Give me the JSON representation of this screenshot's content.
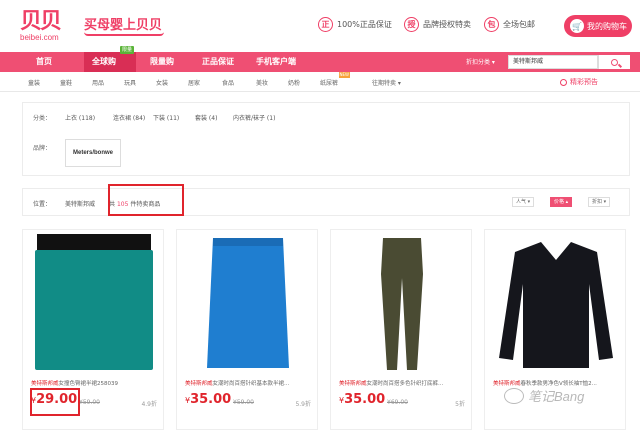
{
  "header": {
    "logo_glyph": "贝贝",
    "logo_domain": "beibei.com",
    "slogan": "买母婴上贝贝",
    "promises": [
      {
        "icon": "正",
        "label": "100%正品保证"
      },
      {
        "icon": "授",
        "label": "品牌授权特卖"
      },
      {
        "icon": "包",
        "label": "全场包邮"
      }
    ],
    "cart_label": "我的购物车"
  },
  "nav": {
    "items": [
      "首页",
      "全球购",
      "限量购",
      "正品保证",
      "手机客户端"
    ],
    "badge": "限量",
    "sort_label": "折扣分类 ▾",
    "search_value": "美特斯邦威"
  },
  "subnav": {
    "items": [
      "童装",
      "童鞋",
      "用品",
      "玩具",
      "女装",
      "居家",
      "食品",
      "美妆",
      "奶粉",
      "纸尿裤",
      "往期特卖 ▾"
    ],
    "new_badge": "NEW",
    "preview": "精彩预告"
  },
  "filters": {
    "category_label": "分类：",
    "category_options": [
      "上衣 (118)",
      "连衣裙 (84)",
      "下装 (11)",
      "套装 (4)",
      "内衣裤/袜子 (1)"
    ],
    "brand_label": "品牌：",
    "brand": "Meters/bonwe"
  },
  "location": {
    "label": "位置：",
    "value": "美特斯邦威",
    "count_prefix": "共",
    "count": "105",
    "count_suffix": "件特卖商品",
    "sorts": [
      "人气 ▾",
      "价格 ▴",
      "折扣 ▾"
    ]
  },
  "products": [
    {
      "brand": "美特斯邦威",
      "title": "女撞色臀裙半裙258039",
      "price": "29.00",
      "original": "¥59.00",
      "discount": "4.9折",
      "color": "#118c86"
    },
    {
      "brand": "美特斯邦威",
      "title": "女潮时尚百搭针织基本款半裙...",
      "price": "35.00",
      "original": "¥59.00",
      "discount": "5.9折",
      "color": "#1f7ed0"
    },
    {
      "brand": "美特斯邦威",
      "title": "女潮时尚百搭多色针织打底裤...",
      "price": "35.00",
      "original": "¥69.00",
      "discount": "5折",
      "color": "#4a4b33"
    },
    {
      "brand": "美特斯邦威",
      "title": "春秋季款男净色V领长袖T恤2...",
      "price": "29.00",
      "original": "",
      "discount": "",
      "color": "#15161c"
    }
  ],
  "currency": "¥",
  "watermark": "笔记Bang"
}
